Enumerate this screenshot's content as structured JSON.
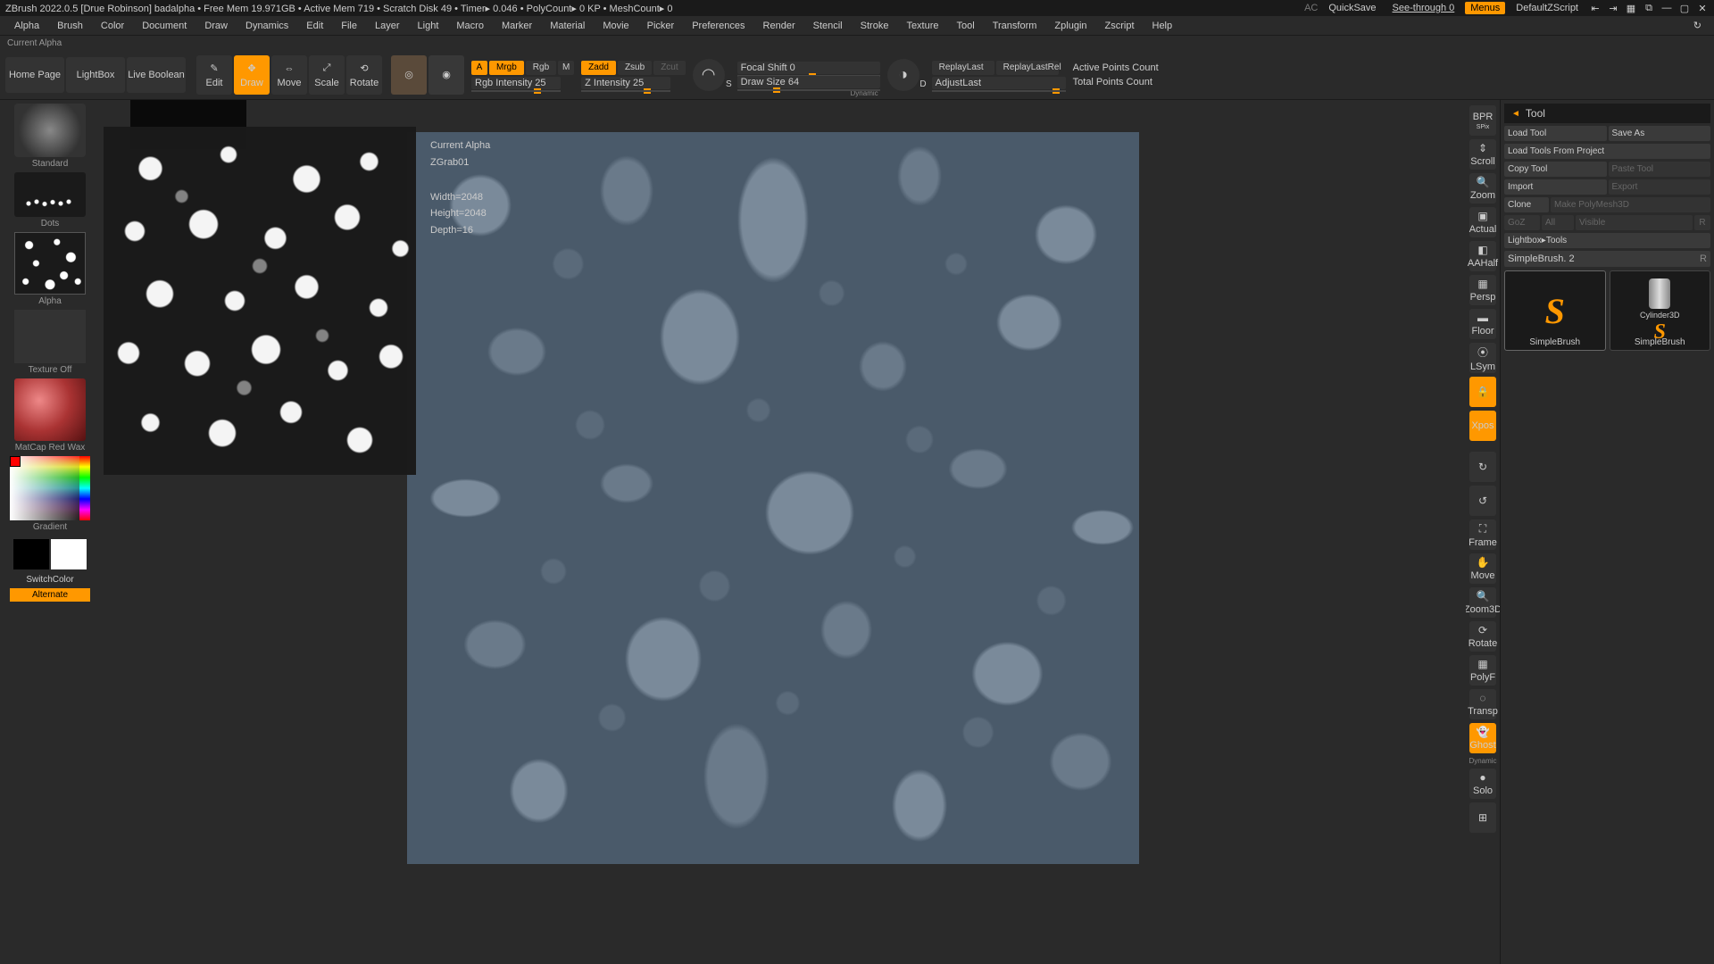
{
  "titlebar": {
    "text": "ZBrush 2022.0.5 [Drue Robinson]   badalpha     • Free Mem 19.971GB • Active Mem 719 • Scratch Disk 49 • Timer▸ 0.046 • PolyCount▸ 0 KP  • MeshCount▸ 0",
    "ac": "AC",
    "quicksave": "QuickSave",
    "seethrough": "See-through  0",
    "menus": "Menus",
    "script": "DefaultZScript"
  },
  "menus": [
    "Alpha",
    "Brush",
    "Color",
    "Document",
    "Draw",
    "Dynamics",
    "Edit",
    "File",
    "Layer",
    "Light",
    "Macro",
    "Marker",
    "Material",
    "Movie",
    "Picker",
    "Preferences",
    "Render",
    "Stencil",
    "Stroke",
    "Texture",
    "Tool",
    "Transform",
    "Zplugin",
    "Zscript",
    "Help"
  ],
  "statusline": "Current Alpha",
  "toolbar": {
    "homepage": "Home Page",
    "lightbox": "LightBox",
    "liveboolean": "Live Boolean",
    "edit": "Edit",
    "draw": "Draw",
    "move": "Move",
    "scale": "Scale",
    "rotate": "Rotate",
    "a": "A",
    "mrgb": "Mrgb",
    "rgb": "Rgb",
    "m": "M",
    "zadd": "Zadd",
    "zsub": "Zsub",
    "zcut": "Zcut",
    "rgbintensity": "Rgb Intensity 25",
    "zintensity": "Z Intensity 25",
    "focalshift": "Focal Shift 0",
    "drawsize": "Draw Size 64",
    "dynamic": "Dynamic",
    "replaylast": "ReplayLast",
    "replaylastrel": "ReplayLastRel",
    "adjustlast": "AdjustLast",
    "activepoints": "Active Points Count",
    "totalpoints": "Total Points Count",
    "s": "S",
    "d": "D"
  },
  "left": {
    "standard": "Standard",
    "dots": "Dots",
    "alpha": "Alpha",
    "textureoff": "Texture Off",
    "matcap": "MatCap Red Wax",
    "gradient": "Gradient",
    "switchcolor": "SwitchColor",
    "alternate": "Alternate"
  },
  "alphainfo": {
    "title": "Current Alpha",
    "name": "ZGrab01",
    "width": "Width=2048",
    "height": "Height=2048",
    "depth": "Depth=16"
  },
  "shelf": {
    "bpr": "BPR",
    "spix": "SPix",
    "scroll": "Scroll",
    "zoom": "Zoom",
    "actual": "Actual",
    "aahalf": "AAHalf",
    "persp": "Persp",
    "floor": "Floor",
    "lsym": "LSym",
    "lock": "",
    "xyz": "Xpos",
    "frame": "Frame",
    "move": "Move",
    "zoom3d": "Zoom3D",
    "rotate": "Rotate",
    "polyf": "PolyF",
    "transp": "Transp",
    "ghost": "Ghost",
    "dynamic": "Dynamic",
    "solo": "Solo"
  },
  "tool": {
    "header": "Tool",
    "loadtool": "Load Tool",
    "saveas": "Save As",
    "loadproject": "Load Tools From Project",
    "copytool": "Copy Tool",
    "pastetool": "Paste Tool",
    "import": "Import",
    "export": "Export",
    "clone": "Clone",
    "polymesh": "Make PolyMesh3D",
    "goz": "GoZ",
    "all": "All",
    "visible": "Visible",
    "r1": "R",
    "lightbox": "Lightbox▸Tools",
    "simplebrush": "SimpleBrush. 2",
    "r2": "R",
    "thumb1": "SimpleBrush",
    "thumb2": "Cylinder3D",
    "thumb3": "SimpleBrush"
  }
}
